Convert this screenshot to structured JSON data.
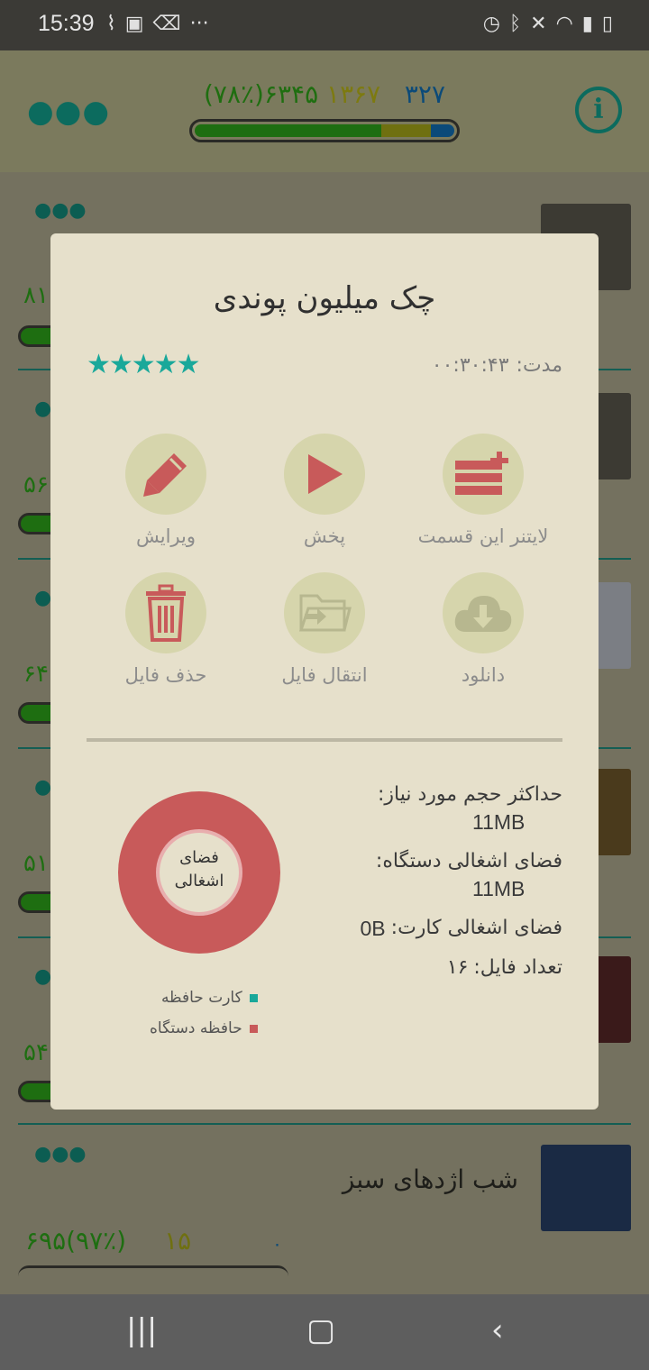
{
  "status_bar": {
    "time": "15:39",
    "left_icons": [
      "broom-icon",
      "image-icon",
      "trash-icon",
      "more-icon"
    ],
    "right_icons": [
      "alarm-icon",
      "bluetooth-icon",
      "mute-icon",
      "wifi-icon",
      "signal-icon",
      "battery-icon"
    ]
  },
  "app_bar": {
    "stat_total": "۶۳۴۵(۷۸٪)",
    "stat_mid": "۱۳۶۷",
    "stat_right": "۳۲۷",
    "progress": {
      "green": 0.72,
      "yellow": 0.19,
      "blue": 0.09
    }
  },
  "rows": [
    {
      "num": "۸۱"
    },
    {
      "num": "۵۶"
    },
    {
      "num": "۶۴"
    },
    {
      "num": "۵۱"
    },
    {
      "num": "۵۴"
    }
  ],
  "last_item": {
    "title": "شب اژدهای سبز",
    "stat_a": "۶۹۵(۹۷٪)",
    "stat_b": "۱۵",
    "stat_c": "۰"
  },
  "dialog": {
    "title": "چک میلیون پوندی",
    "rating": 5,
    "stars": "★★★★★",
    "duration_label": "مدت:",
    "duration_value": "۰۰:۳۰:۴۳",
    "actions": [
      {
        "label": "لایتنر این قسمت",
        "icon": "leitner-add-icon"
      },
      {
        "label": "پخش",
        "icon": "play-icon"
      },
      {
        "label": "ویرایش",
        "icon": "pencil-icon"
      },
      {
        "label": "دانلود",
        "icon": "cloud-download-icon"
      },
      {
        "label": "انتقال فایل",
        "icon": "folder-move-icon"
      },
      {
        "label": "حذف فایل",
        "icon": "trash-icon"
      }
    ],
    "info": {
      "max_size_label": "حداکثر حجم مورد نیاز:",
      "max_size_value": "11MB",
      "device_label": "فضای اشغالی دستگاه:",
      "device_value": "11MB",
      "card_label": "فضای اشغالی کارت:",
      "card_value": "0B",
      "files_label": "تعداد فایل:",
      "files_value": "۱۶"
    },
    "donut": {
      "center_line1": "فضای",
      "center_line2": "اشغالی",
      "legend": [
        {
          "label": "کارت حافظه",
          "color": "#19a89a"
        },
        {
          "label": "حافظه دستگاه",
          "color": "#c85a5a"
        }
      ]
    }
  },
  "colors": {
    "accent": "#19a89a",
    "danger": "#c85a5a",
    "dialog_bg": "#e6e0cb",
    "circle_bg": "#d6d5ac"
  }
}
